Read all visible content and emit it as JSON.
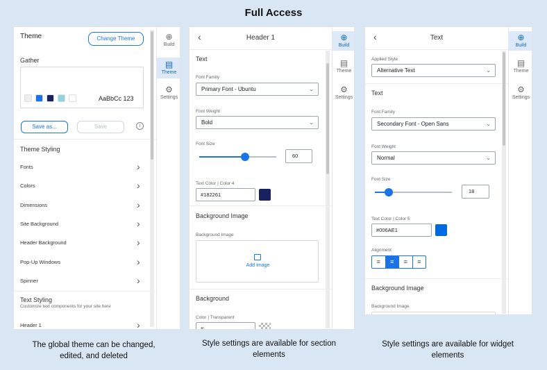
{
  "title": "Full Access",
  "captions": {
    "left": "The global theme can be changed, edited, and deleted",
    "middle": "Style settings are available for section elements",
    "right": "Style settings are available for widget elements"
  },
  "rail": {
    "build": "Build",
    "theme": "Theme",
    "settings": "Settings"
  },
  "theme_panel": {
    "heading": "Theme",
    "change_button": "Change Theme",
    "theme_name": "Gather",
    "preview_text": "AaBbCc 123",
    "swatches": [
      "#eeeeee",
      "#1a73e8",
      "#182261",
      "#8fd3df",
      "#ffffff"
    ],
    "save_as": "Save as...",
    "save": "Save",
    "styling_heading": "Theme Styling",
    "styling_items": [
      "Fonts",
      "Colors",
      "Dimensions",
      "Site Background",
      "Header Background",
      "Pop-Up Windows",
      "Spinner"
    ],
    "text_styling_heading": "Text Styling",
    "text_styling_desc": "Customize text components for your site here",
    "text_items": [
      "Header 1"
    ]
  },
  "section_panel": {
    "header": "Header 1",
    "text_label": "Text",
    "font_family_label": "Font Family",
    "font_family_value": "Primary Font - Ubuntu",
    "font_weight_label": "Font Weight",
    "font_weight_value": "Bold",
    "font_size_label": "Font Size",
    "font_size_value": "60",
    "text_color_label": "Text Color | Color 4",
    "text_color_value": "#182261",
    "text_color_swatch": "#182261",
    "bg_image_heading": "Background Image",
    "bg_image_label": "Background Image",
    "add_image": "Add Image",
    "background_heading": "Background",
    "bg_color_label": "Color | Transparent",
    "bg_color_value": "#"
  },
  "widget_panel": {
    "header": "Text",
    "applied_style_label": "Applied Style",
    "applied_style_value": "Alternative Text",
    "text_label": "Text",
    "font_family_label": "Font Family",
    "font_family_value": "Secondary Font - Open Sans",
    "font_weight_label": "Font Weight",
    "font_weight_value": "Normal",
    "font_size_label": "Font Size",
    "font_size_value": "18",
    "text_color_label": "Text Color | Color 5",
    "text_color_value": "#006AE1",
    "text_color_swatch": "#006ae1",
    "alignment_label": "Alignment",
    "bg_image_heading": "Background Image",
    "bg_image_label": "Background Image"
  }
}
